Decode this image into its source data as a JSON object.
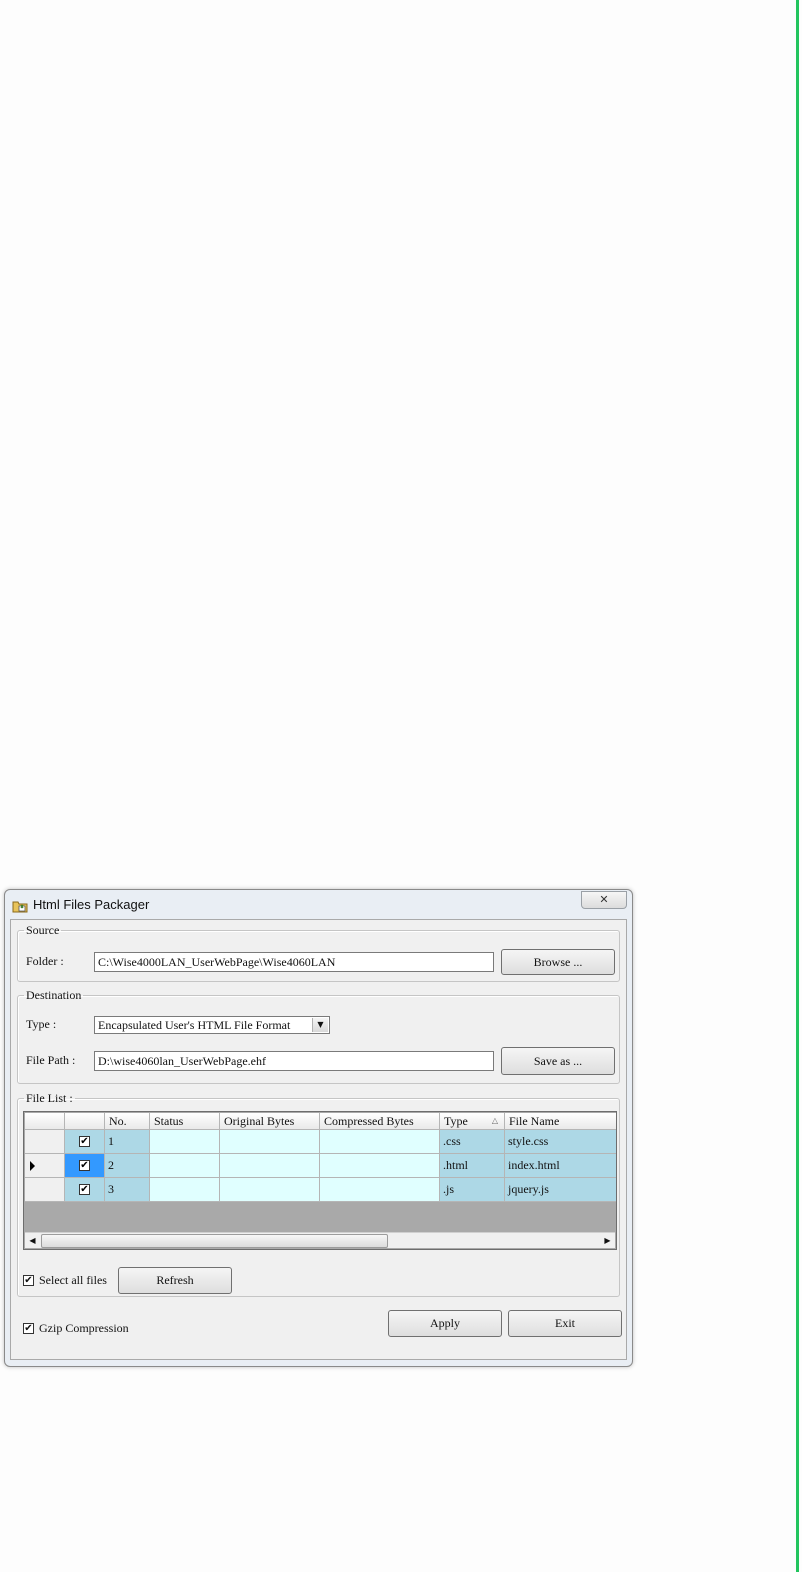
{
  "window": {
    "title": "Html Files Packager",
    "close_glyph": "✕"
  },
  "source": {
    "legend": "Source",
    "folder_label": "Folder :",
    "folder_value": "C:\\Wise4000LAN_UserWebPage\\Wise4060LAN",
    "browse_label": "Browse ..."
  },
  "destination": {
    "legend": "Destination",
    "type_label": "Type :",
    "type_value": "Encapsulated User's HTML File Format",
    "filepath_label": "File Path :",
    "filepath_value": "D:\\wise4060lan_UserWebPage.ehf",
    "saveas_label": "Save as ..."
  },
  "filelist": {
    "legend": "File List :",
    "columns": [
      "",
      "",
      "No.",
      "Status",
      "Original Bytes",
      "Compressed Bytes",
      "Type",
      "File Name"
    ],
    "rows": [
      {
        "checked": true,
        "no": "1",
        "status": "",
        "original": "",
        "compressed": "",
        "type": ".css",
        "name": "style.css",
        "current": false
      },
      {
        "checked": true,
        "no": "2",
        "status": "",
        "original": "",
        "compressed": "",
        "type": ".html",
        "name": "index.html",
        "current": true
      },
      {
        "checked": true,
        "no": "3",
        "status": "",
        "original": "",
        "compressed": "",
        "type": ".js",
        "name": "jquery.js",
        "current": false
      }
    ],
    "select_all_label": "Select all files",
    "select_all_checked": true,
    "refresh_label": "Refresh"
  },
  "footer": {
    "gzip_label": "Gzip Compression",
    "gzip_checked": true,
    "apply_label": "Apply",
    "exit_label": "Exit"
  },
  "colors": {
    "row_blue": "#add8e6",
    "row_light": "#e0ffff",
    "selected_cell": "#3399ff",
    "accent_line": "#22c55e"
  },
  "icons": {
    "window": "folder-package-icon",
    "checkmark": "✔",
    "scroll_left": "◀",
    "scroll_right": "▶",
    "dropdown": "▼",
    "sort": "△"
  }
}
